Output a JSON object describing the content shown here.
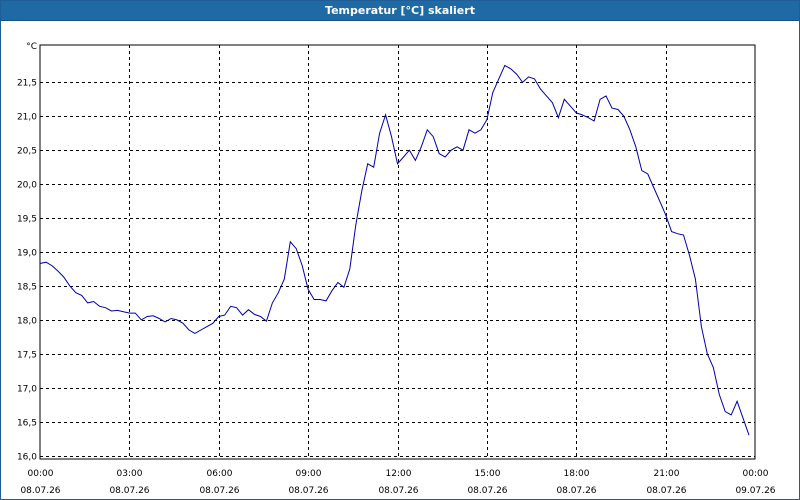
{
  "window": {
    "title": "Temperatur [°C] skaliert",
    "title_bar_color": "#1d6aa4"
  },
  "chart_data": {
    "type": "line",
    "title": "Temperatur [°C] skaliert",
    "ylabel": "°C",
    "xlabel": "",
    "ylim": [
      15.95,
      22.05
    ],
    "xlim": [
      0,
      24
    ],
    "grid": true,
    "line_color": "#0000aa",
    "y_ticks": [
      "16,0",
      "16,5",
      "17,0",
      "17,5",
      "18,0",
      "18,5",
      "19,0",
      "19,5",
      "20,0",
      "20,5",
      "21,0",
      "21,5"
    ],
    "y_tick_values": [
      16.0,
      16.5,
      17.0,
      17.5,
      18.0,
      18.5,
      19.0,
      19.5,
      20.0,
      20.5,
      21.0,
      21.5
    ],
    "x_ticks": [
      {
        "time": "00:00",
        "date": "08.07.26"
      },
      {
        "time": "03:00",
        "date": "08.07.26"
      },
      {
        "time": "06:00",
        "date": "08.07.26"
      },
      {
        "time": "09:00",
        "date": "08.07.26"
      },
      {
        "time": "12:00",
        "date": "08.07.26"
      },
      {
        "time": "15:00",
        "date": "08.07.26"
      },
      {
        "time": "18:00",
        "date": "08.07.26"
      },
      {
        "time": "21:00",
        "date": "08.07.26"
      },
      {
        "time": "00:00",
        "date": "09.07.26"
      }
    ],
    "x_tick_values": [
      0,
      3,
      6,
      9,
      12,
      15,
      18,
      21,
      24
    ],
    "series": [
      {
        "x": [
          0.0,
          0.2,
          0.4,
          0.6,
          0.8,
          1.0,
          1.2,
          1.4,
          1.6,
          1.8,
          2.0,
          2.2,
          2.4,
          2.6,
          2.8,
          3.0,
          3.2,
          3.4,
          3.6,
          3.8,
          4.0,
          4.2,
          4.4,
          4.6,
          4.8,
          5.0,
          5.2,
          5.4,
          5.6,
          5.8,
          6.0,
          6.2,
          6.4,
          6.6,
          6.8,
          7.0,
          7.2,
          7.4,
          7.6,
          7.8,
          8.0,
          8.2,
          8.4,
          8.6,
          8.8,
          9.0,
          9.2,
          9.4,
          9.6,
          9.8,
          10.0,
          10.2,
          10.4,
          10.6,
          10.8,
          11.0,
          11.2,
          11.4,
          11.6,
          11.8,
          12.0,
          12.2,
          12.4,
          12.6,
          12.8,
          13.0,
          13.2,
          13.4,
          13.6,
          13.8,
          14.0,
          14.2,
          14.4,
          14.6,
          14.8,
          15.0,
          15.2,
          15.4,
          15.6,
          15.8,
          16.0,
          16.2,
          16.4,
          16.6,
          16.8,
          17.0,
          17.2,
          17.4,
          17.6,
          17.8,
          18.0,
          18.2,
          18.4,
          18.6,
          18.8,
          19.0,
          19.2,
          19.4,
          19.6,
          19.8,
          20.0,
          20.2,
          20.4,
          20.6,
          20.8,
          21.0,
          21.2,
          21.4,
          21.6,
          21.8,
          22.0,
          22.2,
          22.4,
          22.6,
          22.8,
          23.0,
          23.2,
          23.4,
          23.6,
          23.8
        ],
        "values": [
          18.83,
          18.85,
          18.8,
          18.72,
          18.63,
          18.5,
          18.4,
          18.36,
          18.25,
          18.27,
          18.2,
          18.18,
          18.13,
          18.14,
          18.12,
          18.1,
          18.1,
          18.0,
          18.05,
          18.06,
          18.02,
          17.97,
          18.02,
          18.0,
          17.95,
          17.85,
          17.8,
          17.85,
          17.9,
          17.95,
          18.05,
          18.07,
          18.2,
          18.18,
          18.07,
          18.15,
          18.08,
          18.05,
          17.98,
          18.25,
          18.4,
          18.6,
          19.15,
          19.05,
          18.8,
          18.45,
          18.3,
          18.3,
          18.28,
          18.43,
          18.55,
          18.48,
          18.75,
          19.4,
          19.9,
          20.3,
          20.25,
          20.75,
          21.02,
          20.7,
          20.3,
          20.4,
          20.5,
          20.35,
          20.55,
          20.8,
          20.7,
          20.45,
          20.4,
          20.5,
          20.55,
          20.5,
          20.8,
          20.75,
          20.8,
          20.95,
          21.35,
          21.55,
          21.75,
          21.7,
          21.62,
          21.5,
          21.58,
          21.55,
          21.4,
          21.3,
          21.2,
          20.98,
          21.25,
          21.15,
          21.05,
          21.02,
          20.98,
          20.93,
          21.25,
          21.3,
          21.12,
          21.1,
          21.0,
          20.8,
          20.55,
          20.2,
          20.15,
          19.95,
          19.75,
          19.55,
          19.3,
          19.27,
          19.25,
          18.95,
          18.6,
          17.9,
          17.5,
          17.3,
          16.9,
          16.65,
          16.6,
          16.8,
          16.55,
          16.3
        ]
      }
    ]
  }
}
